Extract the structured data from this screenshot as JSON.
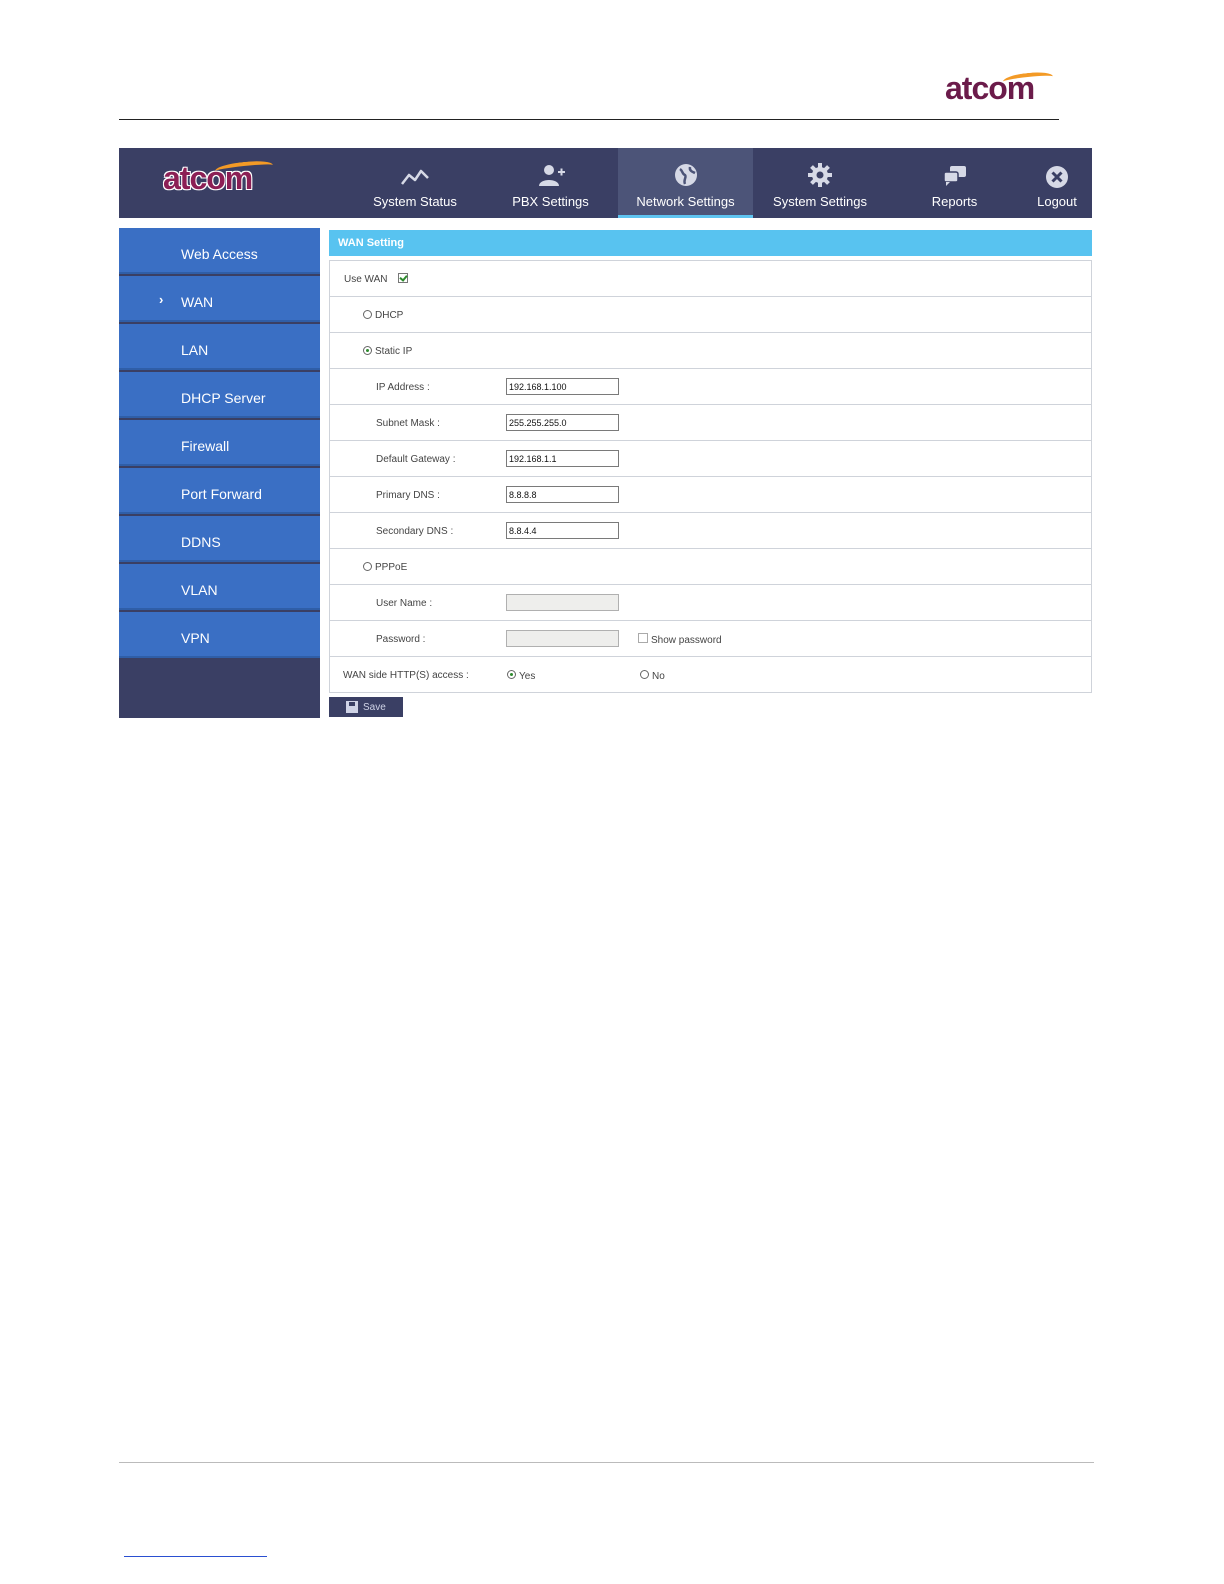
{
  "brand": {
    "logo": "atcom",
    "swoosh_color": "#f39a26",
    "logo_color": "#6b1b4a"
  },
  "nav": {
    "items": [
      {
        "label": "System Status",
        "icon": "chart-line-icon"
      },
      {
        "label": "PBX Settings",
        "icon": "user-add-icon"
      },
      {
        "label": "Network Settings",
        "icon": "globe-icon",
        "active": true
      },
      {
        "label": "System Settings",
        "icon": "gear-icon"
      },
      {
        "label": "Reports",
        "icon": "chat-bubbles-icon"
      },
      {
        "label": "Logout",
        "icon": "close-circle-icon"
      }
    ]
  },
  "sidebar": {
    "items": [
      {
        "label": "Web Access"
      },
      {
        "label": "WAN",
        "active": true
      },
      {
        "label": "LAN"
      },
      {
        "label": "DHCP Server"
      },
      {
        "label": "Firewall"
      },
      {
        "label": "Port Forward"
      },
      {
        "label": "DDNS"
      },
      {
        "label": "VLAN"
      },
      {
        "label": "VPN"
      }
    ]
  },
  "panel": {
    "title": "WAN Setting",
    "use_wan_label": "Use WAN",
    "use_wan_checked": true,
    "dhcp_label": "DHCP",
    "static_ip_label": "Static IP",
    "selected_mode": "Static IP",
    "ip_address_label": "IP Address :",
    "ip_address_value": "192.168.1.100",
    "subnet_mask_label": "Subnet Mask :",
    "subnet_mask_value": "255.255.255.0",
    "gateway_label": "Default Gateway :",
    "gateway_value": "192.168.1.1",
    "primary_dns_label": "Primary DNS :",
    "primary_dns_value": "8.8.8.8",
    "secondary_dns_label": "Secondary DNS :",
    "secondary_dns_value": "8.8.4.4",
    "pppoe_label": "PPPoE",
    "username_label": "User Name :",
    "password_label": "Password :",
    "show_password_label": "Show password",
    "http_access_label": "WAN side HTTP(S) access :",
    "yes_label": "Yes",
    "no_label": "No",
    "http_access_selected": "Yes",
    "save_label": "Save"
  },
  "colors": {
    "topbar": "#3a3f64",
    "sidebar_item": "#3a6fc4",
    "panel_header": "#58c3f0",
    "active_underline": "#5ec4f0"
  }
}
